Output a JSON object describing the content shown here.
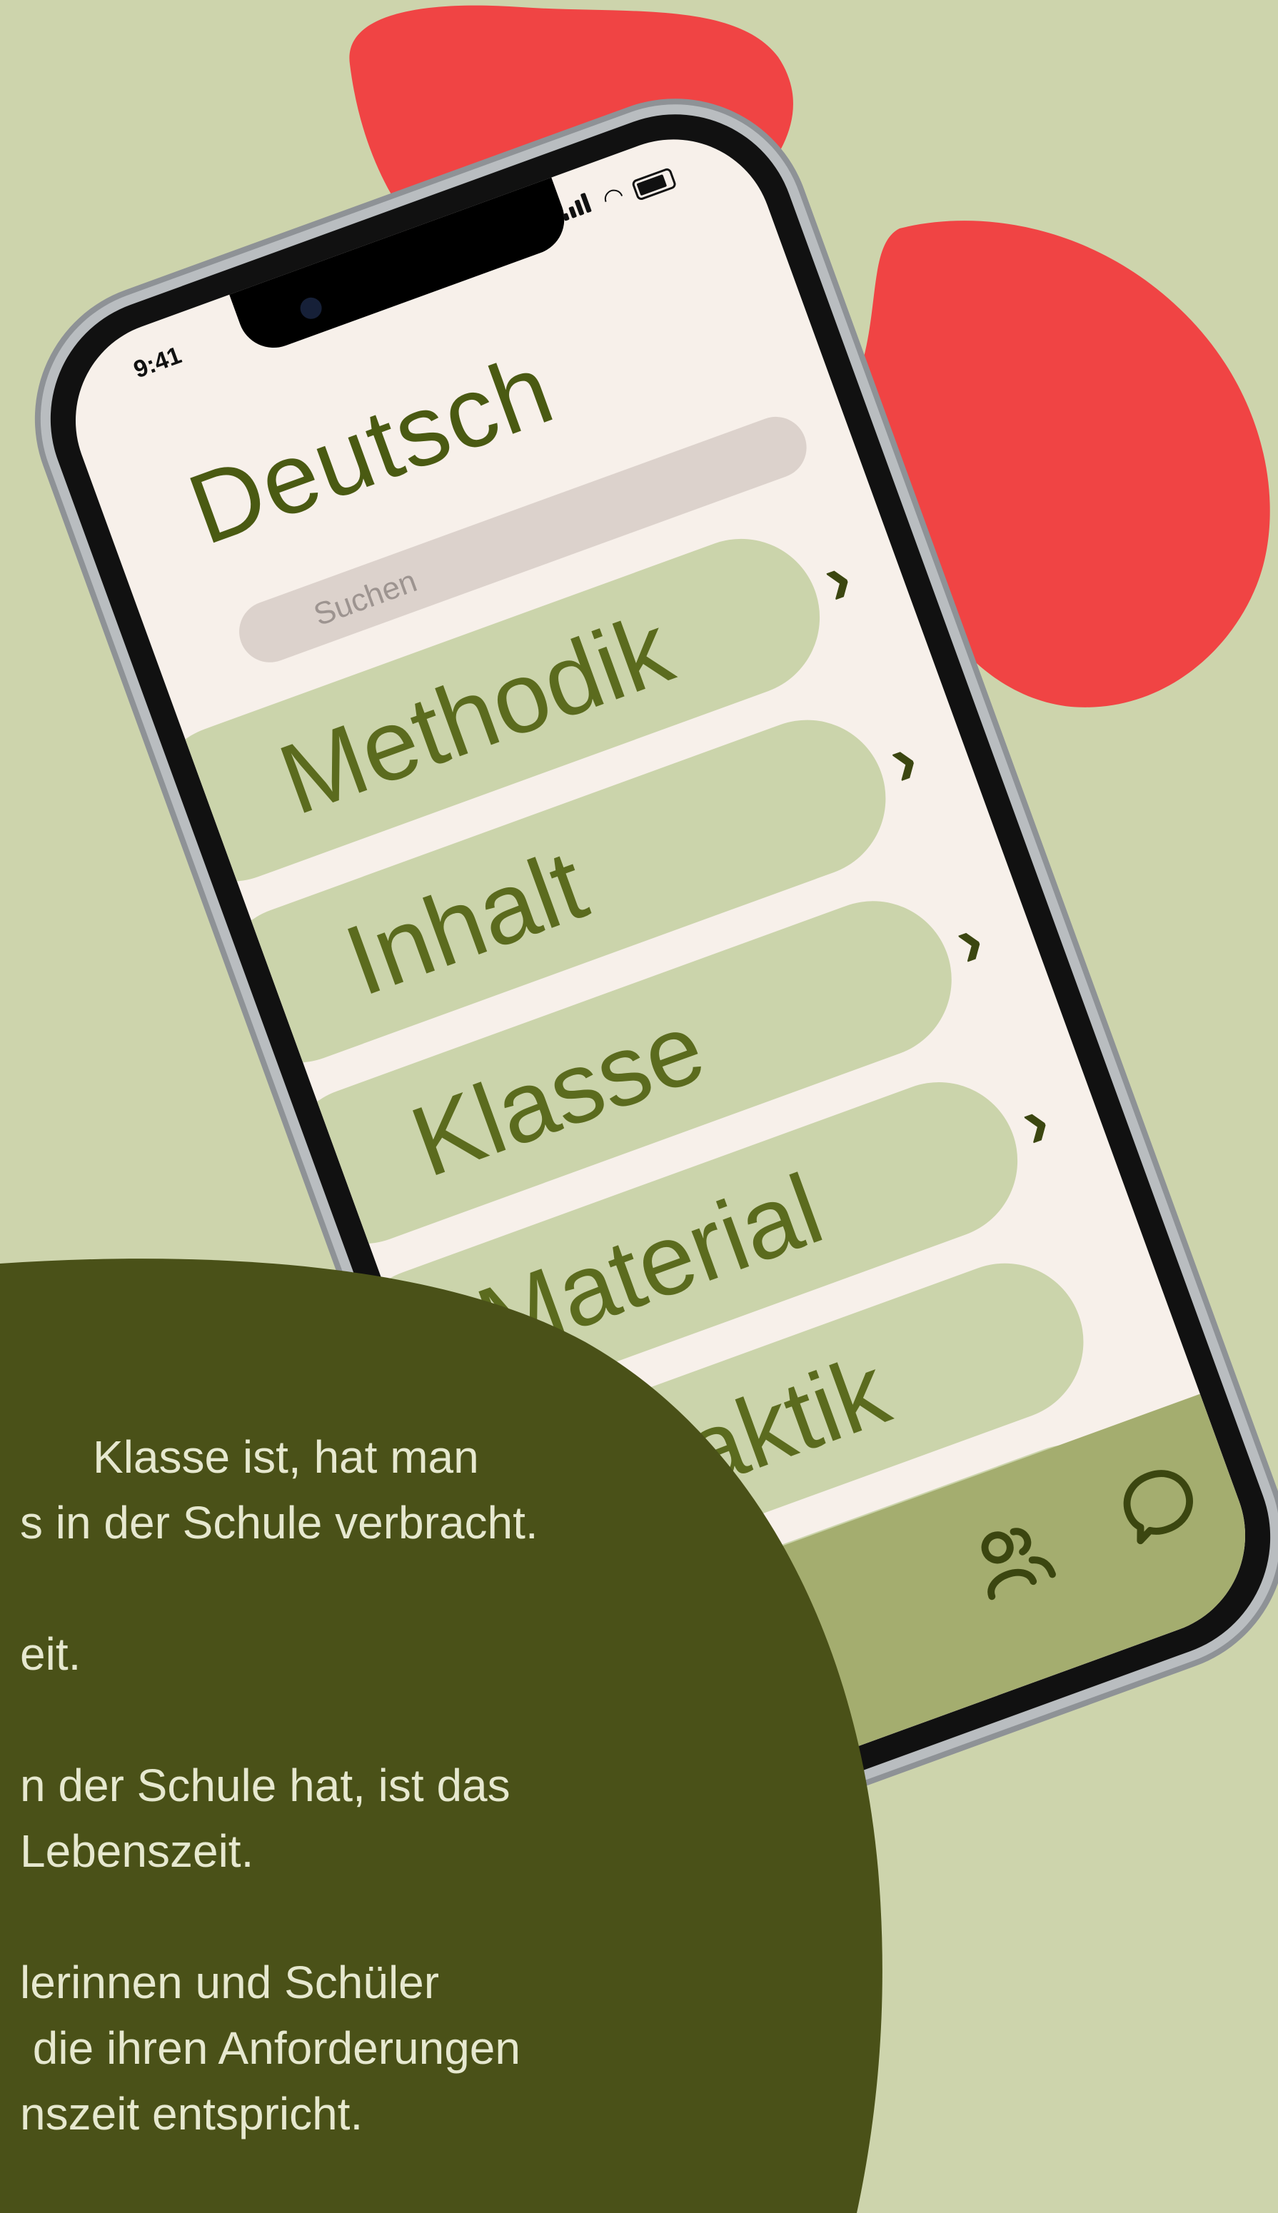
{
  "phone": {
    "status_time": "9:41",
    "title": "Deutsch",
    "search_placeholder": "Suchen",
    "menu": [
      {
        "label": "Methodik"
      },
      {
        "label": "Inhalt"
      },
      {
        "label": "Klasse"
      },
      {
        "label": "Material"
      },
      {
        "label": "Didaktik"
      },
      {
        "label": ""
      }
    ],
    "tabs": [
      {
        "icon": "users-icon"
      },
      {
        "icon": "chat-icon"
      }
    ]
  },
  "panel": {
    "lines": [
      "Klasse ist, hat man",
      "s in der Schule verbracht.",
      "",
      "eit.",
      "",
      "n der Schule hat, ist das",
      "Lebenszeit.",
      "",
      "lerinnen und Schüler",
      " die ihren Anforderungen",
      "nszeit entspricht."
    ]
  },
  "colors": {
    "background": "#cdd4ac",
    "accent_red": "#f04444",
    "panel_green": "#4a5118",
    "pill_green": "#cbd4ab",
    "tabbar_green": "#a4ad6f",
    "screen_bg": "#f7f0ea"
  }
}
